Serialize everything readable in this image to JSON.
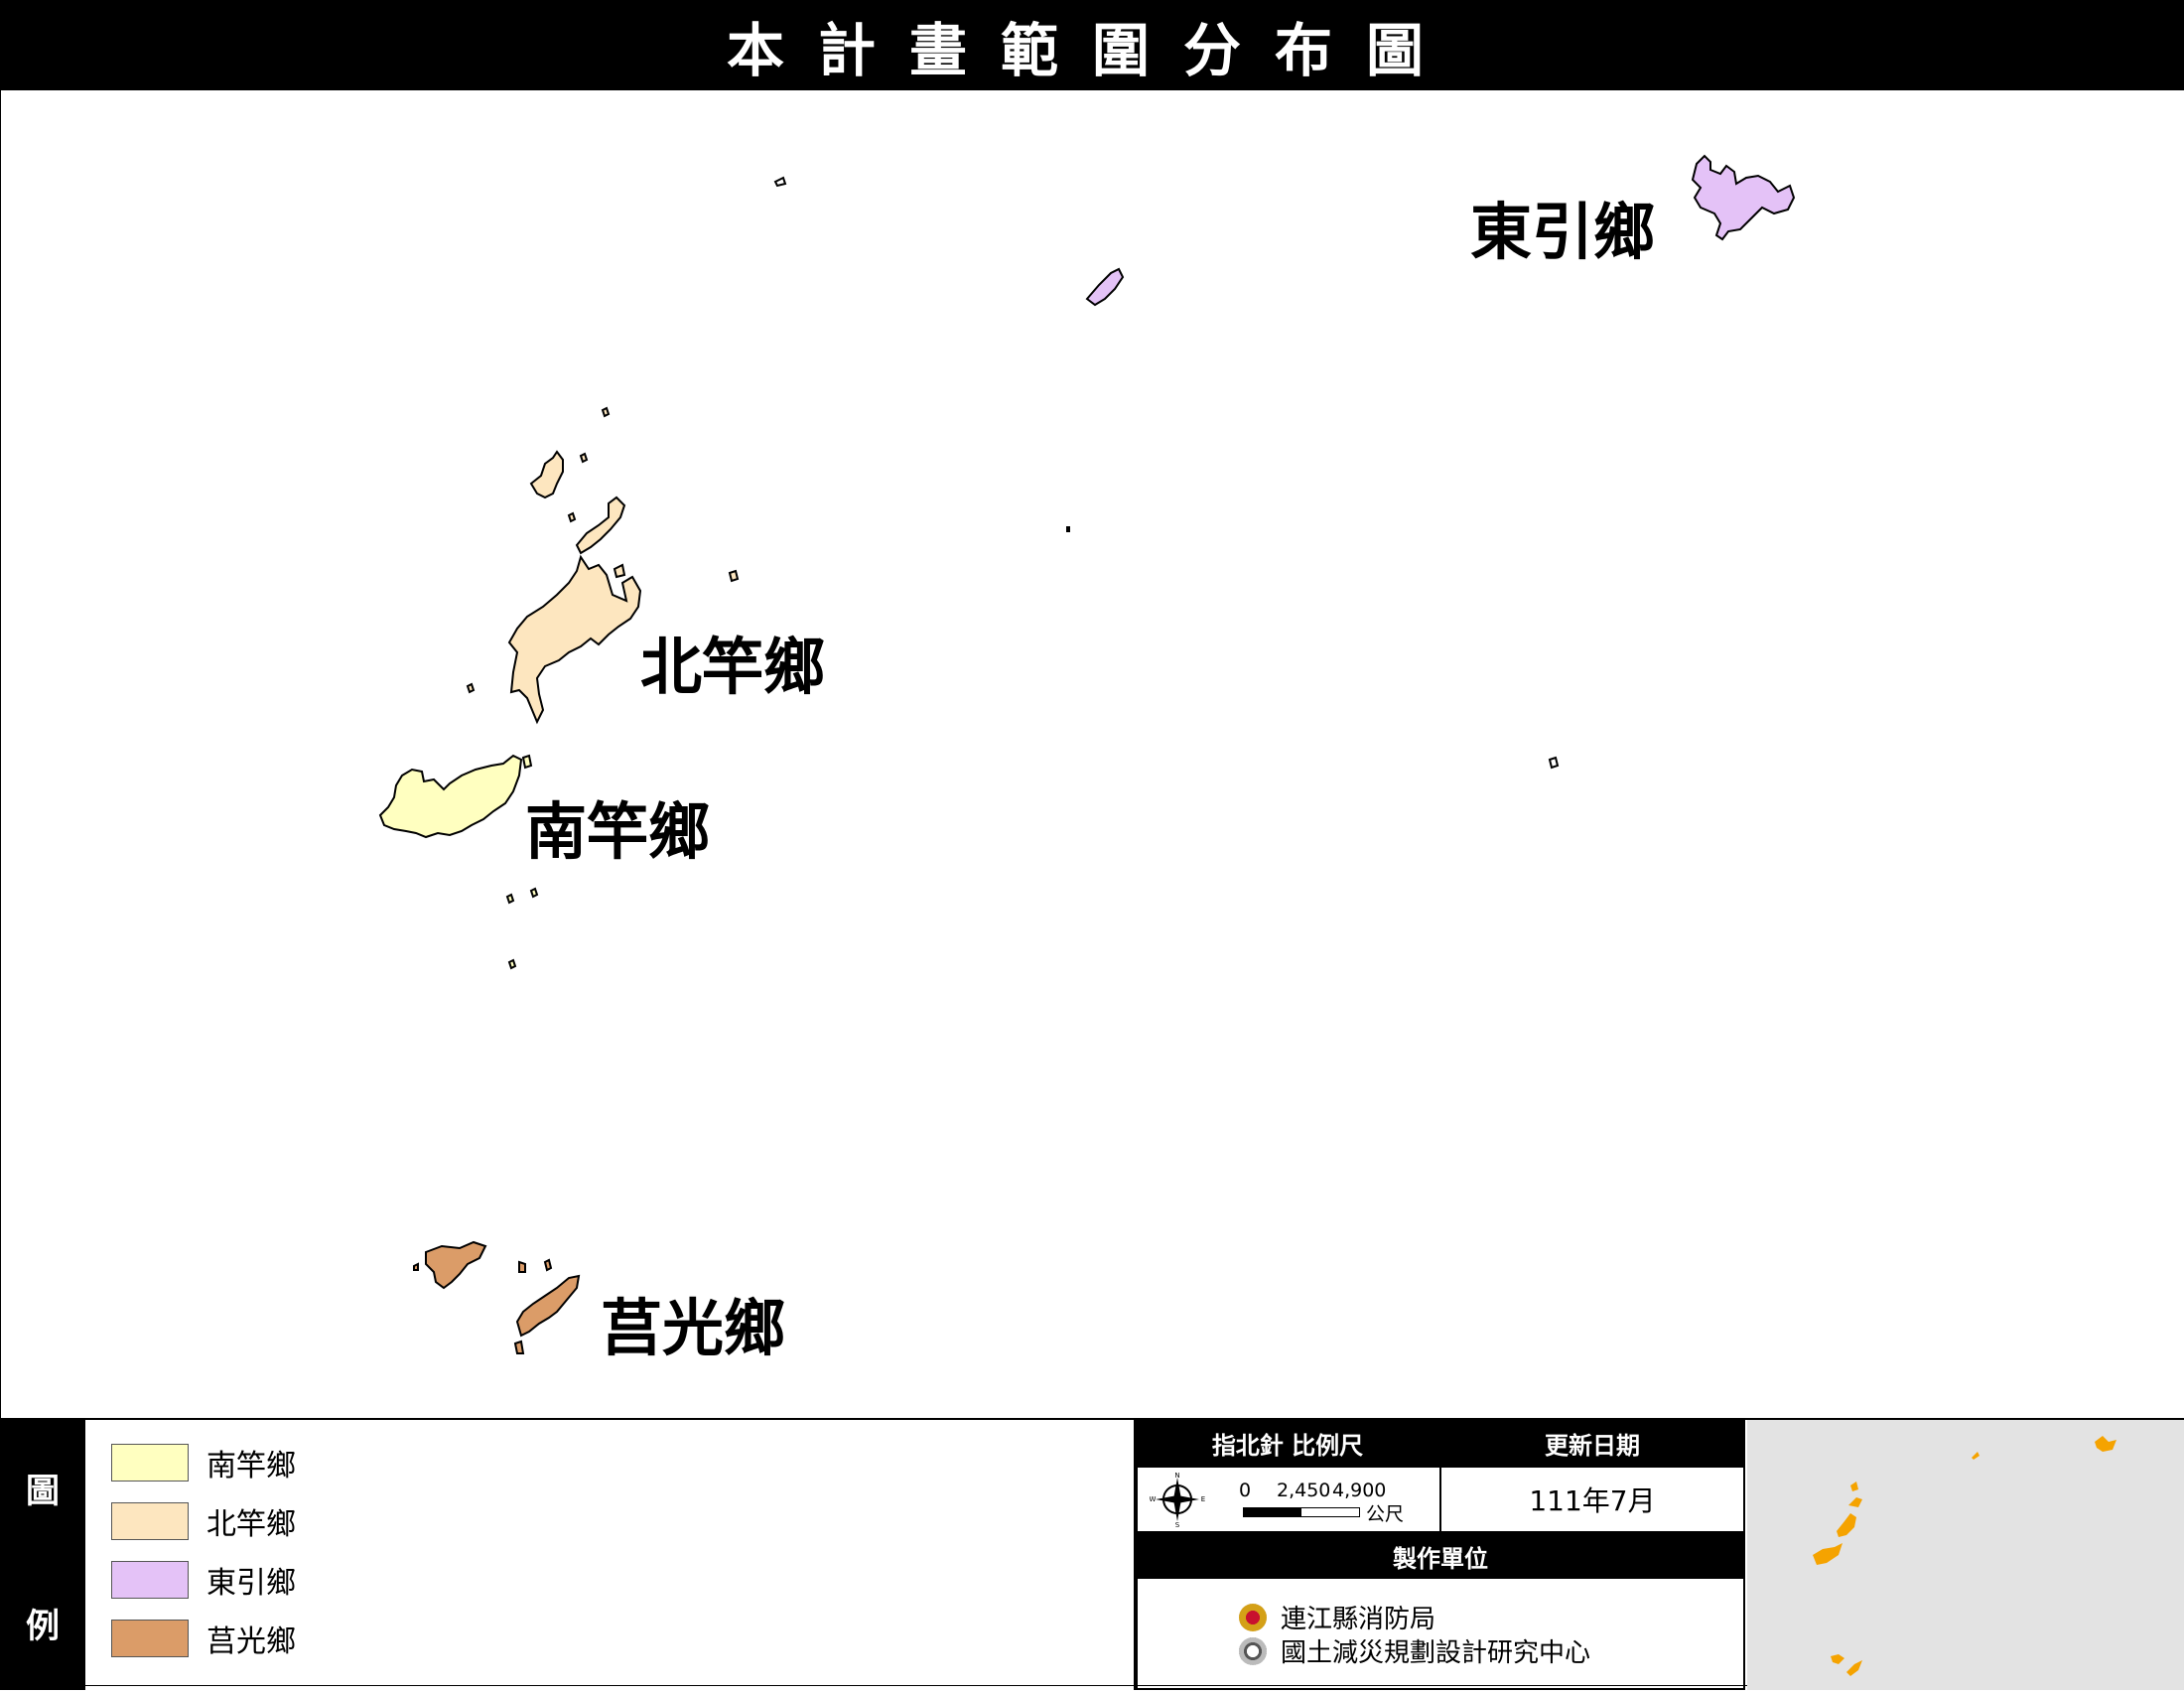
{
  "title": "本計畫範圍分布圖",
  "towns": [
    {
      "name": "南竿鄉",
      "color": "#FFFFC0"
    },
    {
      "name": "北竿鄉",
      "color": "#FDE6BF"
    },
    {
      "name": "東引鄉",
      "color": "#E4C2F7"
    },
    {
      "name": "莒光鄉",
      "color": "#DB9C68"
    }
  ],
  "legend": {
    "side_label_top": "圖",
    "side_label_bottom": "例"
  },
  "info": {
    "compass_scale_header": "指北針 比例尺",
    "date_header": "更新日期",
    "date_value": "111年7月",
    "scale_labels": [
      "0",
      "2,450",
      "4,900"
    ],
    "scale_unit": "公尺",
    "compass_letters": {
      "n": "N",
      "s": "S",
      "e": "E",
      "w": "W"
    },
    "maker_header": "製作單位",
    "makers": [
      "連江縣消防局",
      "國土減災規劃設計研究中心"
    ]
  },
  "inset": {
    "background": "#E3E3E3",
    "highlight_color": "#F5A300"
  }
}
